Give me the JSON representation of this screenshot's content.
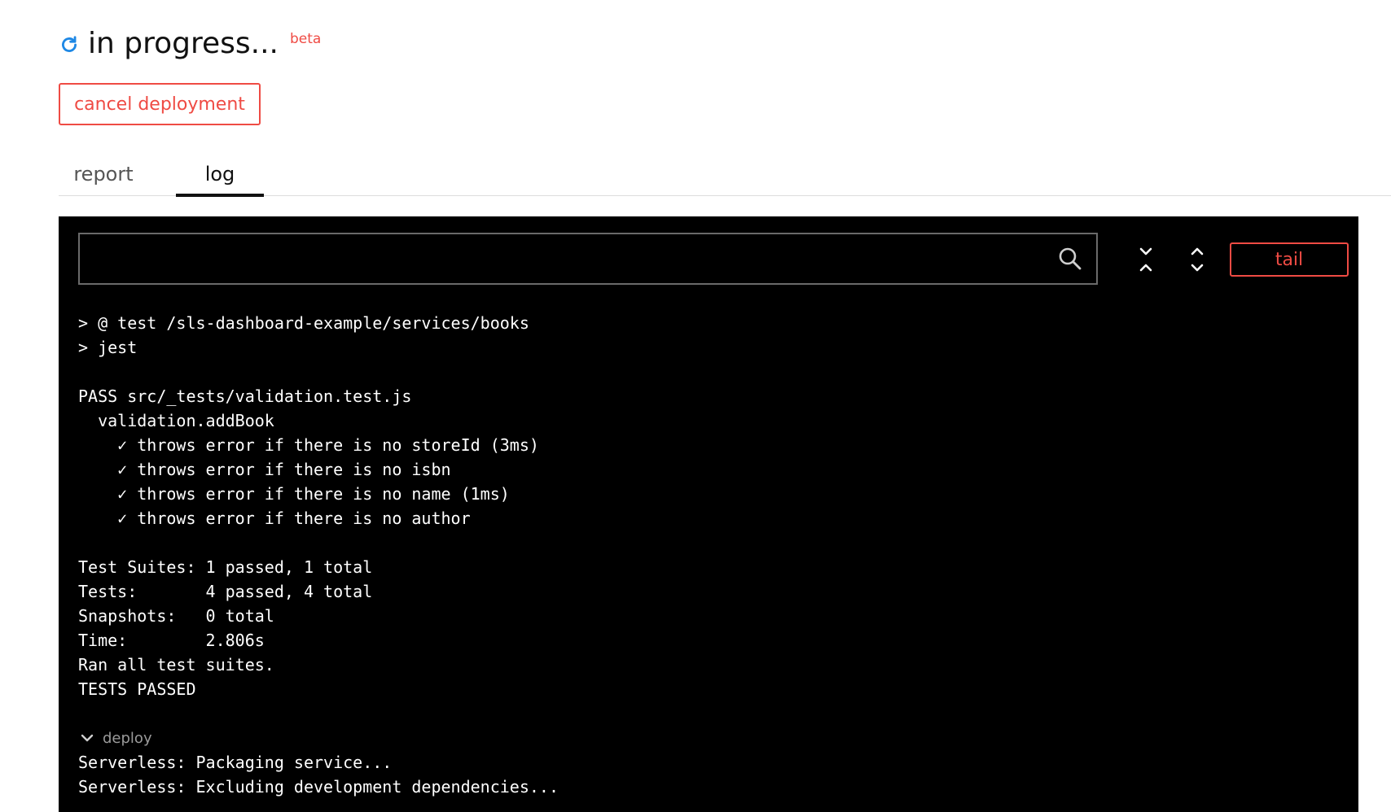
{
  "header": {
    "status_title": "in progress...",
    "beta_label": "beta",
    "status_color": "#1e88e5"
  },
  "actions": {
    "cancel_label": "cancel deployment"
  },
  "tabs": [
    {
      "label": "report",
      "active": false
    },
    {
      "label": "log",
      "active": true
    }
  ],
  "log": {
    "search_value": "",
    "tail_label": "tail",
    "lines_before": [
      "> @ test /sls-dashboard-example/services/books",
      "> jest",
      "",
      "PASS src/_tests/validation.test.js",
      "  validation.addBook",
      "    ✓ throws error if there is no storeId (3ms)",
      "    ✓ throws error if there is no isbn",
      "    ✓ throws error if there is no name (1ms)",
      "    ✓ throws error if there is no author",
      "",
      "Test Suites: 1 passed, 1 total",
      "Tests:       4 passed, 4 total",
      "Snapshots:   0 total",
      "Time:        2.806s",
      "Ran all test suites.",
      "TESTS PASSED",
      ""
    ],
    "section_label": "deploy",
    "lines_after": [
      "Serverless: Packaging service...",
      "Serverless: Excluding development dependencies..."
    ]
  },
  "colors": {
    "accent": "#ef4b44",
    "log_background": "#000000",
    "log_text": "#ffffff",
    "muted": "#9a9a9a"
  },
  "icons": {
    "status": "refresh-icon",
    "search": "search-icon",
    "collapse": "collapse-all-icon",
    "expand": "expand-all-icon",
    "section": "chevron-down-icon"
  }
}
